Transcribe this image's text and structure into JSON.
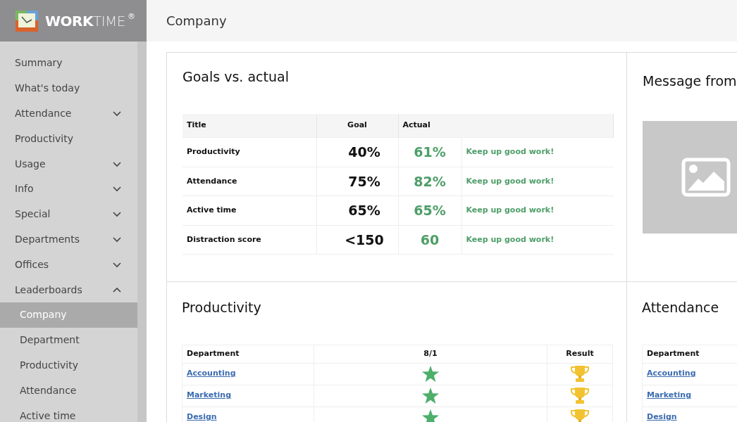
{
  "brand": {
    "bold": "WORK",
    "light": "TIME",
    "mark": "®"
  },
  "page_title": "Company",
  "sidebar": {
    "items": [
      {
        "label": "Summary",
        "selected": false
      },
      {
        "label": "What's today",
        "selected": false
      },
      {
        "label": "Attendance",
        "expanded": false,
        "selected": false
      },
      {
        "label": "Productivity",
        "selected": false
      },
      {
        "label": "Usage",
        "expanded": false,
        "selected": false
      },
      {
        "label": "Info",
        "expanded": false,
        "selected": false
      },
      {
        "label": "Special",
        "expanded": false,
        "selected": false
      },
      {
        "label": "Departments",
        "expanded": false,
        "selected": false
      },
      {
        "label": "Offices",
        "expanded": false,
        "selected": false
      },
      {
        "label": "Leaderboards",
        "expanded": true,
        "selected": false,
        "children": [
          {
            "label": "Company",
            "selected": true
          },
          {
            "label": "Department",
            "selected": false
          },
          {
            "label": "Productivity",
            "selected": false
          },
          {
            "label": "Attendance",
            "selected": false
          },
          {
            "label": "Active time",
            "selected": false
          }
        ]
      }
    ]
  },
  "goals": {
    "title": "Goals vs. actual",
    "columns": [
      "Title",
      "Goal",
      "Actual"
    ],
    "rows": [
      {
        "title": "Productivity",
        "goal": "40%",
        "actual": "61%",
        "note": "Keep up good work!"
      },
      {
        "title": "Attendance",
        "goal": "75%",
        "actual": "82%",
        "note": "Keep up good work!"
      },
      {
        "title": "Active time",
        "goal": "65%",
        "actual": "65%",
        "note": "Keep up good work!"
      },
      {
        "title": "Distraction score",
        "goal": "<150",
        "actual": "60",
        "note": "Keep up good work!"
      }
    ]
  },
  "message": {
    "title": "Message from"
  },
  "productivity": {
    "title": "Productivity",
    "columns": [
      "Department",
      "8/1",
      "Result"
    ],
    "rows": [
      {
        "department": "Accounting",
        "achieved": true
      },
      {
        "department": "Marketing",
        "achieved": true
      },
      {
        "department": "Design",
        "achieved": true
      }
    ]
  },
  "attendance": {
    "title": "Attendance",
    "columns": [
      "Department"
    ],
    "rows": [
      {
        "department": "Accounting"
      },
      {
        "department": "Marketing"
      },
      {
        "department": "Design"
      }
    ]
  }
}
